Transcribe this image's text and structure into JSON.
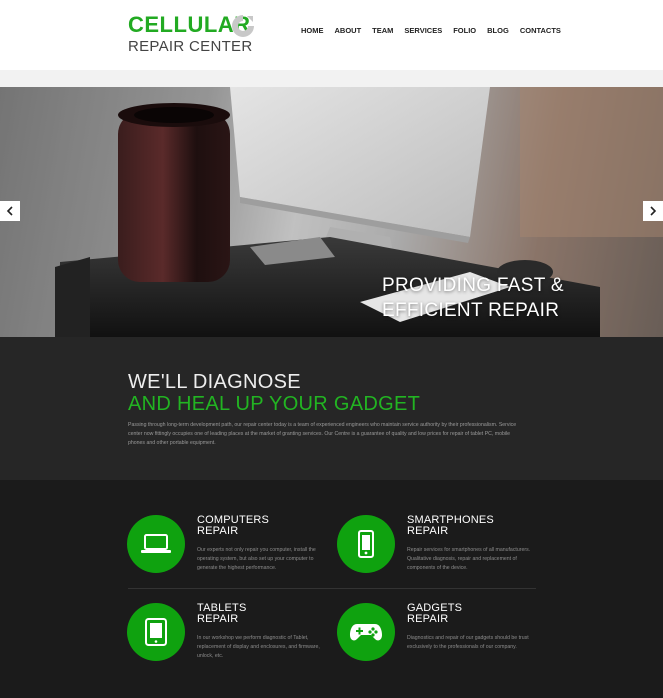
{
  "logo": {
    "top": "CELLULAR",
    "bottom": "REPAIR CENTER"
  },
  "nav": [
    "HOME",
    "ABOUT",
    "TEAM",
    "SERVICES",
    "FOLIO",
    "BLOG",
    "CONTACTS"
  ],
  "hero": {
    "title_line1": "PROVIDING FAST &",
    "title_line2": "EFFICIENT REPAIR"
  },
  "diagnose": {
    "heading_line1": "WE'LL DIAGNOSE",
    "heading_line2": "AND HEAL UP YOUR GADGET",
    "paragraph": "Passing through long-term development path, our repair center today is a team of experienced engineers who maintain service authority by their professionalism. Service center now fittingly occupies one of leading places at the market of granting services. Our Centre is a guarantee of quality and low prices for repair of tablet PC, mobile phones and other portable equipment."
  },
  "services": [
    {
      "title1": "COMPUTERS",
      "title2": "REPAIR",
      "icon": "laptop-icon",
      "desc": "Our experts not only repair you computer, install the operating system, but also set up your computer to generate the highest performance."
    },
    {
      "title1": "SMARTPHONES",
      "title2": "REPAIR",
      "icon": "smartphone-icon",
      "desc": "Repair services for smartphones of all manufacturers. Qualitative diagnosis, repair and replacement of components of the device."
    },
    {
      "title1": "TABLETS",
      "title2": "REPAIR",
      "icon": "tablet-icon",
      "desc": "In our workshop we perform diagnostic of Tablet, replacement of display and enclosures, and firmware, unlock, etc."
    },
    {
      "title1": "GADGETS",
      "title2": "REPAIR",
      "icon": "gamepad-icon",
      "desc": "Diagnostics and repair of our gadgets should be trust exclusively to the professionals of our company."
    }
  ],
  "colors": {
    "accent": "#0fa20f",
    "dark": "#1b1b1b"
  }
}
